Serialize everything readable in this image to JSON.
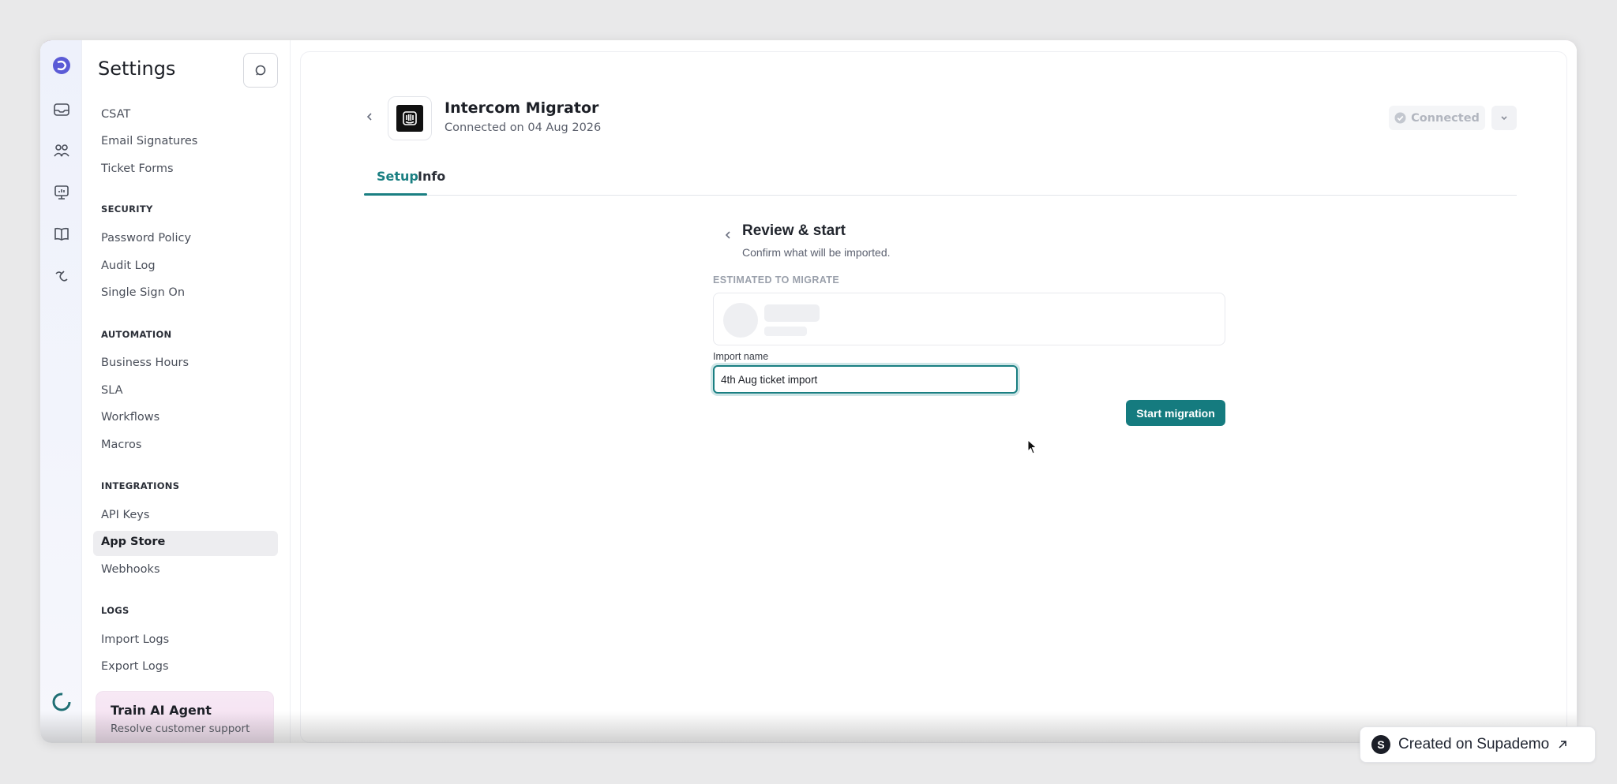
{
  "sidebar": {
    "title": "Settings",
    "items_top": [
      "CSAT",
      "Email Signatures",
      "Ticket Forms"
    ],
    "security": {
      "label": "SECURITY",
      "items": [
        "Password Policy",
        "Audit Log",
        "Single Sign On"
      ]
    },
    "automation": {
      "label": "AUTOMATION",
      "items": [
        "Business Hours",
        "SLA",
        "Workflows",
        "Macros"
      ]
    },
    "integrations": {
      "label": "INTEGRATIONS",
      "items": [
        "API Keys",
        "App Store",
        "Webhooks"
      ]
    },
    "logs": {
      "label": "LOGS",
      "items": [
        "Import Logs",
        "Export Logs"
      ]
    },
    "card": {
      "title": "Train AI Agent",
      "desc": "Resolve customer support"
    }
  },
  "rail": {
    "icons": [
      "logo-icon",
      "inbox-icon",
      "contacts-icon",
      "reports-icon",
      "knowledge-icon",
      "ai-icon"
    ]
  },
  "header": {
    "app_name": "Intercom Migrator",
    "connected_on": "Connected on 04 Aug 2026",
    "status": "Connected"
  },
  "tabs": [
    {
      "label": "Setup",
      "active": true
    },
    {
      "label": "Info",
      "active": false
    }
  ],
  "review": {
    "title": "Review & start",
    "subtitle": "Confirm what will be imported.",
    "estimated_label": "ESTIMATED TO MIGRATE",
    "import_name_label": "Import name",
    "import_name_value": "4th Aug ticket import",
    "start_button": "Start migration"
  },
  "footer": {
    "badge": "Created on Supademo"
  },
  "colors": {
    "accent": "#157b7f",
    "active_item_bg": "#ededf0"
  }
}
